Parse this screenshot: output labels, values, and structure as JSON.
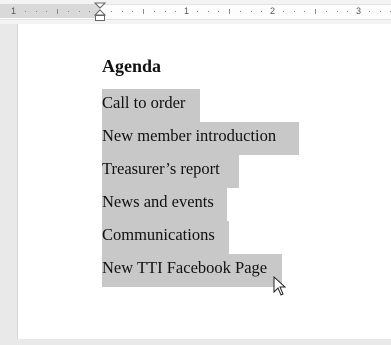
{
  "ruler": {
    "numbers": [
      "1",
      "1",
      "2",
      "3"
    ]
  },
  "document": {
    "heading": "Agenda",
    "items": [
      "Call to order",
      "New member introduction",
      "Treasurer’s report",
      "News and events",
      "Communications",
      "New TTI Facebook Page"
    ],
    "selection_color": "#c8c8c8"
  },
  "icons": {
    "indent": "indent-marker-icon",
    "cursor": "mouse-pointer-icon"
  }
}
